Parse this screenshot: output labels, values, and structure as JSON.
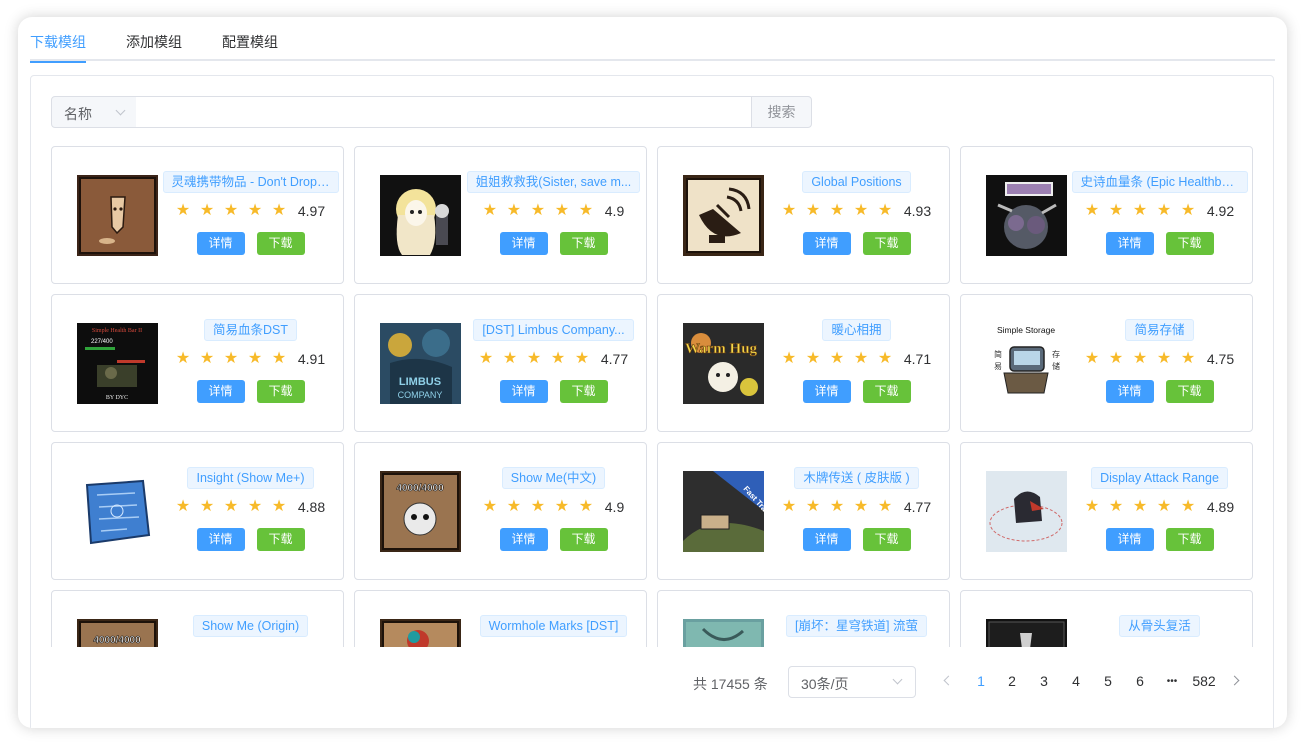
{
  "tabs": [
    {
      "label": "下载模组"
    },
    {
      "label": "添加模组"
    },
    {
      "label": "配置模组"
    }
  ],
  "search": {
    "field_label": "名称",
    "input_value": "",
    "button_label": "搜索"
  },
  "card_buttons": {
    "detail": "详情",
    "download": "下载"
  },
  "star_glyph": "★",
  "mods": [
    {
      "name": "灵魂携带物品 - Don't Drop ...",
      "rating": "4.97"
    },
    {
      "name": "姐姐救救我(Sister, save m...",
      "rating": "4.9"
    },
    {
      "name": "Global Positions",
      "rating": "4.93"
    },
    {
      "name": "史诗血量条 (Epic Healthba...",
      "rating": "4.92"
    },
    {
      "name": "简易血条DST",
      "rating": "4.91"
    },
    {
      "name": "[DST] Limbus Company...",
      "rating": "4.77"
    },
    {
      "name": "暖心相拥",
      "rating": "4.71"
    },
    {
      "name": "简易存储",
      "rating": "4.75"
    },
    {
      "name": "Insight (Show Me+)",
      "rating": "4.88"
    },
    {
      "name": "Show Me(中文)",
      "rating": "4.9"
    },
    {
      "name": "木牌传送 ( 皮肤版 )",
      "rating": "4.77"
    },
    {
      "name": "Display Attack Range",
      "rating": "4.89"
    },
    {
      "name": "Show Me (Origin)",
      "rating": ""
    },
    {
      "name": "Wormhole Marks [DST]",
      "rating": ""
    },
    {
      "name": "[崩坏：星穹铁道] 流萤",
      "rating": ""
    },
    {
      "name": "从骨头复活",
      "rating": ""
    }
  ],
  "thumb_text": {
    "card5": "Simple Health Bar II",
    "card5_values": "227/400",
    "card5_author": "BY DYC",
    "card6": "LIMBUS COMPANY",
    "card7": "Warm Hug",
    "card8_title": "Simple Storage",
    "card8_left": "简\n易",
    "card8_right": "存\n储",
    "card10": "4000/4000",
    "card11": "Fast Travel",
    "card13": "4000/4000"
  },
  "pagination": {
    "total": "共 17455 条",
    "page_size": "30条/页",
    "pages": [
      "1",
      "2",
      "3",
      "4",
      "5",
      "6",
      "•••",
      "582"
    ],
    "current": "1"
  },
  "colors": {
    "primary": "#409eff",
    "success": "#67c23a",
    "star": "#f7ba2a"
  }
}
